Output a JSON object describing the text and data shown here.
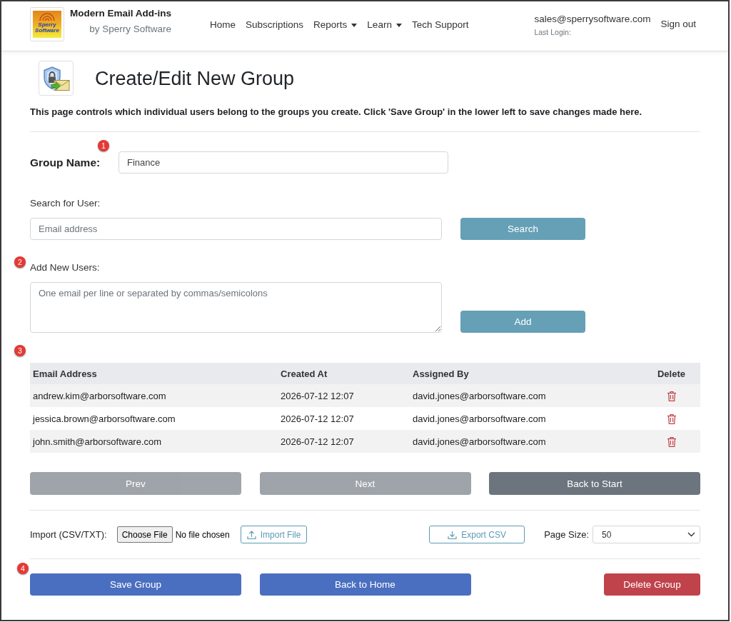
{
  "navbar": {
    "logo_text": "Sperry Software",
    "brand_title": "Modern Email Add-ins",
    "brand_subtitle": "by Sperry Software",
    "links": [
      {
        "label": "Home",
        "dropdown": false
      },
      {
        "label": "Subscriptions",
        "dropdown": false
      },
      {
        "label": "Reports",
        "dropdown": true
      },
      {
        "label": "Learn",
        "dropdown": true
      },
      {
        "label": "Tech Support",
        "dropdown": false
      }
    ],
    "user_email": "sales@sperrysoftware.com",
    "last_login_label": "Last Login:",
    "sign_out": "Sign out"
  },
  "page": {
    "title": "Create/Edit New Group",
    "description": "This page controls which individual users belong to the groups you create. Click 'Save Group' in the lower left to save changes made here."
  },
  "group_name": {
    "label": "Group Name:",
    "value": "Finance"
  },
  "search": {
    "label": "Search for User:",
    "placeholder": "Email address",
    "button": "Search"
  },
  "add_users": {
    "label": "Add New Users:",
    "placeholder": "One email per line or separated by commas/semicolons",
    "button": "Add"
  },
  "table": {
    "columns": [
      "Email Address",
      "Created At",
      "Assigned By",
      "Delete"
    ],
    "rows": [
      {
        "email": "andrew.kim@arborsoftware.com",
        "created_at": "2026-07-12 12:07",
        "assigned_by": "david.jones@arborsoftware.com"
      },
      {
        "email": "jessica.brown@arborsoftware.com",
        "created_at": "2026-07-12 12:07",
        "assigned_by": "david.jones@arborsoftware.com"
      },
      {
        "email": "john.smith@arborsoftware.com",
        "created_at": "2026-07-12 12:07",
        "assigned_by": "david.jones@arborsoftware.com"
      }
    ]
  },
  "pagination": [
    {
      "label": "Prev",
      "disabled": true
    },
    {
      "label": "Next",
      "disabled": true
    },
    {
      "label": "Back to Start",
      "disabled": false
    }
  ],
  "import": {
    "label": "Import (CSV/TXT):",
    "choose_button": "Choose File",
    "file_status": "No file chosen",
    "import_button": "Import File"
  },
  "export_button": "Export CSV",
  "page_size": {
    "label": "Page Size:",
    "value": "50"
  },
  "actions": [
    {
      "label": "Save Group",
      "kind": "primary"
    },
    {
      "label": "Back to Home",
      "kind": "primary"
    },
    {
      "label": "Delete Group",
      "kind": "danger"
    }
  ],
  "annotations": [
    "1",
    "2",
    "3",
    "4"
  ]
}
